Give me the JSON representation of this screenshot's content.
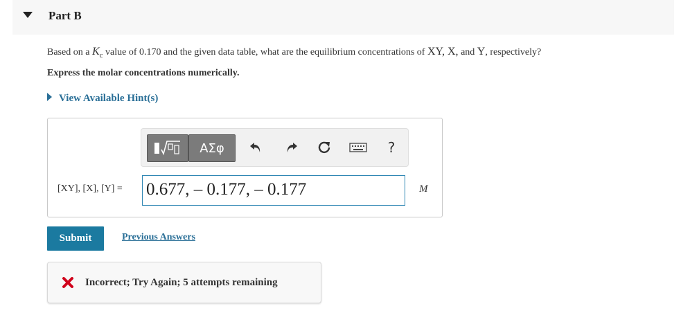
{
  "part": {
    "title": "Part B"
  },
  "question": {
    "prefix": "Based on a ",
    "k_symbol": "K",
    "k_sub": "c",
    "middle": " value of 0.170 and the given data table, what are the equilibrium concentrations of ",
    "species": "XY, X,",
    "and": " and ",
    "last": "Y",
    "suffix": ", respectively?",
    "instruction": "Express the molar concentrations numerically."
  },
  "hint": {
    "label": "View Available Hint(s)"
  },
  "toolbar": {
    "greek_label": "ΑΣφ",
    "help_label": "?",
    "icons": [
      "template-icon",
      "greek-icon",
      "undo-icon",
      "redo-icon",
      "reset-icon",
      "keyboard-icon",
      "help-icon"
    ]
  },
  "answer": {
    "variable_label": "[XY], [X], [Y] =",
    "value": "0.677, – 0.177, – 0.177",
    "unit": "M"
  },
  "actions": {
    "submit_label": "Submit",
    "previous_label": "Previous Answers"
  },
  "feedback": {
    "message": "Incorrect; Try Again; 5 attempts remaining",
    "color": "#d0021b"
  },
  "colors": {
    "accent": "#1b7aa0",
    "link": "#2a6f97",
    "input_border": "#2e86b3"
  }
}
